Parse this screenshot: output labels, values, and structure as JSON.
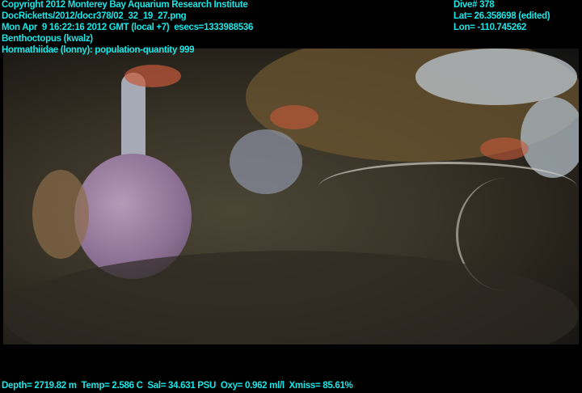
{
  "overlay": {
    "copyright": "Copyright 2012 Monterey Bay Aquarium Research Institute",
    "file": "DocRicketts/2012/docr378/02_32_19_27.png",
    "datetime": "Mon Apr  9 16:22:16 2012 GMT (local +7)  esecs=1333988536",
    "annotation1": "Benthoctopus (kwalz)",
    "annotation2": "Hormathiidae (lonny): population-quantity 999",
    "dive": "Dive# 378",
    "lat": "Lat= 26.358698 (edited)",
    "lon": "Lon= -110.745262",
    "sensors": "Depth= 2719.82 m  Temp= 2.586 C  Sal= 34.631 PSU  Oxy= 0.962 ml/l  Xmiss= 85.61%"
  },
  "colors": {
    "overlay_text": "#19e6e6"
  }
}
